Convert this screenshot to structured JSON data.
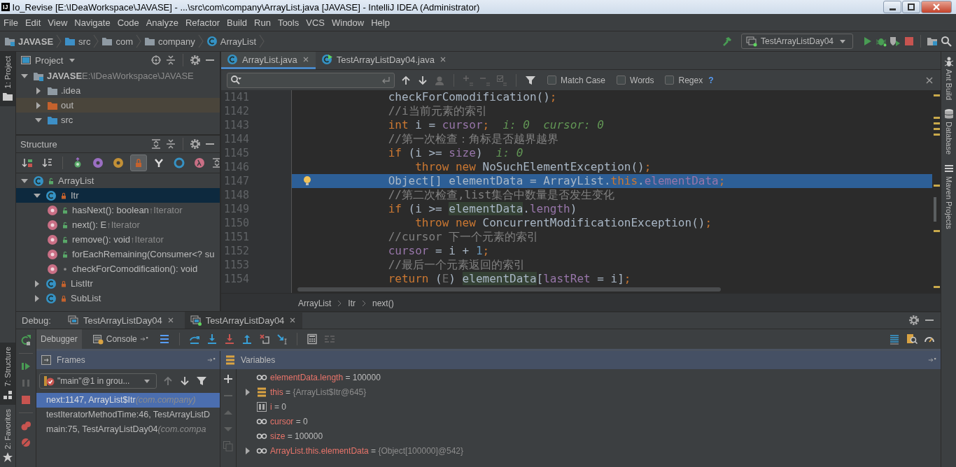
{
  "window": {
    "logo": "IJ",
    "title": "Io_Revise [E:\\IDeaWorkspace\\JAVASE] - ...\\src\\com\\company\\ArrayList.java [JAVASE] - IntelliJ IDEA (Administrator)"
  },
  "menu": [
    "File",
    "Edit",
    "View",
    "Navigate",
    "Code",
    "Analyze",
    "Refactor",
    "Build",
    "Run",
    "Tools",
    "VCS",
    "Window",
    "Help"
  ],
  "navigation_bar": {
    "crumbs": [
      {
        "label": "JAVASE",
        "kind": "module"
      },
      {
        "label": "src",
        "kind": "source"
      },
      {
        "label": "com",
        "kind": "package"
      },
      {
        "label": "company",
        "kind": "package"
      },
      {
        "label": "ArrayList",
        "kind": "class"
      }
    ],
    "run_configuration": "TestArrayListDay04"
  },
  "left_stripe": {
    "top": [
      {
        "label": "1: Project",
        "selected": true
      }
    ],
    "bottom": [
      {
        "label": "7: Structure",
        "selected": true
      },
      {
        "label": "2: Favorites",
        "selected": false
      }
    ]
  },
  "right_stripe": [
    {
      "label": "Ant Build",
      "kind": "ant"
    },
    {
      "label": "Database",
      "kind": "database"
    },
    {
      "label": "Maven Projects",
      "kind": "maven"
    }
  ],
  "project_panel": {
    "title": "Project",
    "tree": [
      {
        "label": "JAVASE",
        "path": "E:\\IDeaWorkspace\\JAVASE",
        "kind": "module",
        "expanded": true,
        "selected": false,
        "children": [
          {
            "label": ".idea",
            "kind": "folder",
            "expanded": false,
            "selected": false
          },
          {
            "label": "out",
            "kind": "excluded",
            "expanded": false,
            "selected": true
          },
          {
            "label": "src",
            "kind": "source",
            "expanded": true,
            "selected": false
          }
        ]
      }
    ]
  },
  "structure_panel": {
    "title": "Structure",
    "toolbar": [
      {
        "kind": "sort-visibility",
        "on": false
      },
      {
        "kind": "sort-alpha",
        "on": false
      },
      {
        "kind": "inherited",
        "on": false
      },
      {
        "kind": "properties",
        "on": false
      },
      {
        "kind": "fields",
        "on": false
      },
      {
        "kind": "non-public",
        "on": true
      },
      {
        "kind": "hierarchy",
        "on": false
      },
      {
        "kind": "anonymous",
        "on": false
      },
      {
        "kind": "lambdas",
        "on": false
      }
    ],
    "tree": [
      {
        "label": "ArrayList",
        "kind": "class-public",
        "expanded": true,
        "selected": false,
        "children": [
          {
            "label": "Itr",
            "kind": "class-private",
            "expanded": true,
            "selected": true,
            "children": [
              {
                "label": "hasNext(): boolean",
                "overrides": "↑Iterator",
                "kind": "method-public",
                "selected": false
              },
              {
                "label": "next(): E",
                "overrides": "↑Iterator",
                "kind": "method-public",
                "selected": false
              },
              {
                "label": "remove(): void",
                "overrides": "↑Iterator",
                "kind": "method-public",
                "selected": false
              },
              {
                "label": "forEachRemaining(Consumer<? su",
                "kind": "method-public",
                "selected": false
              },
              {
                "label": "checkForComodification(): void",
                "kind": "method-package",
                "selected": false
              }
            ]
          },
          {
            "label": "ListItr",
            "kind": "class-private",
            "expanded": false,
            "selected": false
          },
          {
            "label": "SubList",
            "kind": "class-private",
            "expanded": false,
            "selected": false
          }
        ]
      }
    ]
  },
  "editor": {
    "tabs": [
      {
        "label": "ArrayList.java",
        "kind": "class",
        "selected": true
      },
      {
        "label": "TestArrayListDay04.java",
        "kind": "runnable",
        "selected": false
      }
    ],
    "find": {
      "options": [
        {
          "label": "Match Case",
          "checked": false
        },
        {
          "label": "Words",
          "checked": false
        },
        {
          "label": "Regex",
          "checked": false
        }
      ],
      "help": "?"
    },
    "lines": [
      {
        "number": "1141",
        "current": false,
        "tokens": [
          {
            "kind": "plain",
            "text": "checkForComodification()"
          },
          {
            "kind": "keyword",
            "text": ";"
          }
        ]
      },
      {
        "number": "1142",
        "current": false,
        "tokens": [
          {
            "kind": "comment",
            "text": "//i当前元素的索引"
          }
        ]
      },
      {
        "number": "1143",
        "current": false,
        "tokens": [
          {
            "kind": "keyword",
            "text": "int"
          },
          {
            "kind": "plain",
            "text": " i = "
          },
          {
            "kind": "field",
            "text": "cursor"
          },
          {
            "kind": "keyword",
            "text": ";"
          },
          {
            "kind": "hint",
            "text": "  i: 0  cursor: 0"
          }
        ]
      },
      {
        "number": "1144",
        "current": false,
        "tokens": [
          {
            "kind": "comment",
            "text": "//第一次检查：角标是否越界越界"
          }
        ]
      },
      {
        "number": "1145",
        "current": false,
        "tokens": [
          {
            "kind": "keyword",
            "text": "if"
          },
          {
            "kind": "plain",
            "text": " (i >= "
          },
          {
            "kind": "field",
            "text": "size"
          },
          {
            "kind": "plain",
            "text": ")"
          },
          {
            "kind": "hint",
            "text": "  i: 0"
          }
        ]
      },
      {
        "number": "1146",
        "current": false,
        "tokens": [
          {
            "kind": "keyword",
            "text": "    throw new"
          },
          {
            "kind": "plain",
            "text": " NoSuchElementException()"
          },
          {
            "kind": "keyword",
            "text": ";"
          }
        ]
      },
      {
        "number": "1147",
        "current": true,
        "tokens": [
          {
            "kind": "plain",
            "text": "Object[] elementData = ArrayList."
          },
          {
            "kind": "keyword",
            "text": "this"
          },
          {
            "kind": "plain",
            "text": "."
          },
          {
            "kind": "field",
            "text": "elementData"
          },
          {
            "kind": "keyword",
            "text": ";"
          }
        ]
      },
      {
        "number": "1148",
        "current": false,
        "tokens": [
          {
            "kind": "comment",
            "text": "//第二次检查,list集合中数量是否发生变化"
          }
        ]
      },
      {
        "number": "1149",
        "current": false,
        "tokens": [
          {
            "kind": "keyword",
            "text": "if"
          },
          {
            "kind": "plain",
            "text": " (i >= "
          },
          {
            "kind": "usage",
            "text": "elementData"
          },
          {
            "kind": "plain",
            "text": "."
          },
          {
            "kind": "field",
            "text": "length"
          },
          {
            "kind": "plain",
            "text": ")"
          }
        ]
      },
      {
        "number": "1150",
        "current": false,
        "tokens": [
          {
            "kind": "keyword",
            "text": "    throw new"
          },
          {
            "kind": "plain",
            "text": " ConcurrentModificationException()"
          },
          {
            "kind": "keyword",
            "text": ";"
          }
        ]
      },
      {
        "number": "1151",
        "current": false,
        "tokens": [
          {
            "kind": "comment",
            "text": "//cursor 下一个元素的索引"
          }
        ]
      },
      {
        "number": "1152",
        "current": false,
        "tokens": [
          {
            "kind": "field",
            "text": "cursor"
          },
          {
            "kind": "plain",
            "text": " = i + "
          },
          {
            "kind": "number",
            "text": "1"
          },
          {
            "kind": "keyword",
            "text": ";"
          }
        ]
      },
      {
        "number": "1153",
        "current": false,
        "tokens": [
          {
            "kind": "comment",
            "text": "//最后一个元素返回的索引"
          }
        ]
      },
      {
        "number": "1154",
        "current": false,
        "tokens": [
          {
            "kind": "keyword",
            "text": "return"
          },
          {
            "kind": "plain",
            "text": " ("
          },
          {
            "kind": "type",
            "text": "E"
          },
          {
            "kind": "plain",
            "text": ") "
          },
          {
            "kind": "usage",
            "text": "elementData"
          },
          {
            "kind": "plain",
            "text": "["
          },
          {
            "kind": "field",
            "text": "lastRet"
          },
          {
            "kind": "plain",
            "text": " = i]"
          },
          {
            "kind": "keyword",
            "text": ";"
          }
        ]
      }
    ],
    "breadcrumbs": [
      "ArrayList",
      "Itr",
      "next()"
    ]
  },
  "debug": {
    "title": "Debug:",
    "sessions": [
      {
        "label": "TestArrayListDay04",
        "selected": false,
        "running": false
      },
      {
        "label": "TestArrayListDay04",
        "selected": true,
        "running": true
      }
    ],
    "tabs": [
      {
        "label": "Debugger",
        "selected": true
      },
      {
        "label": "Console",
        "selected": false
      }
    ],
    "frames": {
      "title": "Frames",
      "thread": "\"main\"@1 in grou...",
      "items": [
        {
          "method": "next:1147, ArrayList$Itr",
          "package": "(com.company)",
          "selected": true
        },
        {
          "method": "testIteratorMethodTime:46, TestArrayListD",
          "selected": false
        },
        {
          "method": "main:75, TestArrayListDay04",
          "package": "(com.compa",
          "selected": false
        }
      ]
    },
    "variables": {
      "title": "Variables",
      "items": [
        {
          "kind": "watch",
          "name": "elementData.length",
          "equals": "=",
          "value": "100000",
          "expandable": false
        },
        {
          "kind": "object",
          "name": "this",
          "equals": "=",
          "value": "{ArrayList$Itr@645}",
          "expandable": true
        },
        {
          "kind": "local",
          "name": "i",
          "equals": "=",
          "value": "0",
          "expandable": false
        },
        {
          "kind": "watch",
          "name": "cursor",
          "equals": "=",
          "value": "0",
          "expandable": false
        },
        {
          "kind": "watch",
          "name": "size",
          "equals": "=",
          "value": "100000",
          "expandable": false
        },
        {
          "kind": "watch",
          "name": "ArrayList.this.elementData",
          "equals": "=",
          "value": "{Object[100000]@542}",
          "expandable": true
        }
      ]
    }
  }
}
